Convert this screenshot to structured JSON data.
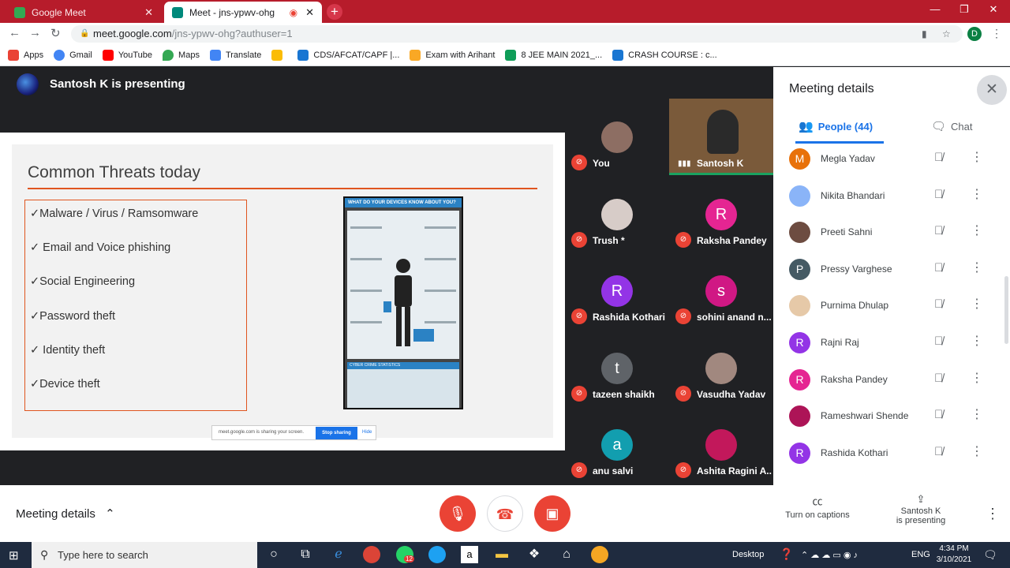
{
  "browser": {
    "tabs": [
      {
        "title": "Google Meet",
        "active": false
      },
      {
        "title": "Meet - jns-ypwv-ohg",
        "active": true
      }
    ],
    "address": {
      "host": "meet.google.com",
      "path": "/jns-ypwv-ohg?authuser=1"
    },
    "profile_initial": "D",
    "bookmarks": [
      "Apps",
      "Gmail",
      "YouTube",
      "Maps",
      "Translate",
      "CDS/AFCAT/CAPF |...",
      "Exam with Arihant",
      "8 JEE MAIN 2021_...",
      "CRASH COURSE : c..."
    ]
  },
  "presenter": {
    "title": "Santosh K is presenting"
  },
  "slide": {
    "title": "Common Threats today",
    "bullets": [
      "✓Malware / Virus / Ramsomware",
      "✓ Email and Voice phishing",
      "✓Social Engineering",
      "✓Password theft",
      "✓ Identity theft",
      "✓Device theft"
    ],
    "infographic_title": "WHAT DO YOUR DEVICES KNOW ABOUT YOU?",
    "infographic_footer": "CYBER CRIME STATISTICS",
    "share_text": "meet.google.com is sharing your screen.",
    "stop_label": "Stop sharing",
    "hide_label": "Hide"
  },
  "tiles": [
    {
      "name": "You",
      "initial": "",
      "color": "#8d6e63",
      "photo": true
    },
    {
      "name": "Santosh K",
      "initial": "",
      "color": "#7a5a3a",
      "video": true
    },
    {
      "name": "Trush *",
      "initial": "",
      "color": "#d7ccc8",
      "photo": true
    },
    {
      "name": "Raksha Pandey",
      "initial": "R",
      "color": "#e52592"
    },
    {
      "name": "Rashida Kothari",
      "initial": "R",
      "color": "#9334e6"
    },
    {
      "name": "sohini anand n...",
      "initial": "s",
      "color": "#d01884"
    },
    {
      "name": "tazeen shaikh",
      "initial": "t",
      "color": "#5f6368"
    },
    {
      "name": "Vasudha Yadav",
      "initial": "",
      "color": "#a1887f",
      "photo": true
    },
    {
      "name": "anu salvi",
      "initial": "a",
      "color": "#129eaf"
    },
    {
      "name": "Ashita Ragini A...",
      "initial": "",
      "color": "#c2185b",
      "photo": true
    }
  ],
  "panel": {
    "title": "Meeting details",
    "people_tab": "People (44)",
    "chat_tab": "Chat",
    "people": [
      {
        "name": "Megla Yadav",
        "initial": "M",
        "color": "#e8710a"
      },
      {
        "name": "Nikita Bhandari",
        "initial": "",
        "color": "#8ab4f8"
      },
      {
        "name": "Preeti Sahni",
        "initial": "",
        "color": "#6d4c41"
      },
      {
        "name": "Pressy Varghese",
        "initial": "P",
        "color": "#455a64"
      },
      {
        "name": "Purnima Dhulap",
        "initial": "",
        "color": "#e6c9a8"
      },
      {
        "name": "Rajni Raj",
        "initial": "R",
        "color": "#9334e6"
      },
      {
        "name": "Raksha Pandey",
        "initial": "R",
        "color": "#e52592"
      },
      {
        "name": "Rameshwari Shende",
        "initial": "",
        "color": "#ad1457"
      },
      {
        "name": "Rashida Kothari",
        "initial": "R",
        "color": "#9334e6"
      }
    ]
  },
  "bottom": {
    "meeting_details": "Meeting details",
    "captions": "Turn on captions",
    "presenting_line1": "Santosh K",
    "presenting_line2": "is presenting"
  },
  "taskbar": {
    "search_placeholder": "Type here to search",
    "desktop": "Desktop",
    "lang": "ENG",
    "time": "4:34 PM",
    "date": "3/10/2021",
    "whatsapp_badge": "12"
  }
}
